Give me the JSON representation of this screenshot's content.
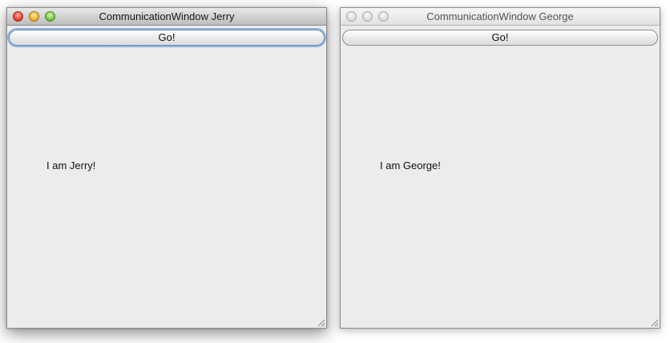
{
  "windows": [
    {
      "title": "CommunicationWindow Jerry",
      "state": "active",
      "button_label": "Go!",
      "message": "I am Jerry!"
    },
    {
      "title": "CommunicationWindow George",
      "state": "inactive",
      "button_label": "Go!",
      "message": "I am George!"
    }
  ],
  "icons": {
    "close": "close-icon",
    "minimize": "minimize-icon",
    "zoom": "zoom-icon",
    "resize": "resize-grip-icon"
  },
  "colors": {
    "window_background": "#ececec",
    "focus_ring": "#8fb3de",
    "close_light": "#f0483c",
    "minimize_light": "#f4b83a",
    "zoom_light": "#7fcc47",
    "inactive_light": "#dcdcdc"
  }
}
